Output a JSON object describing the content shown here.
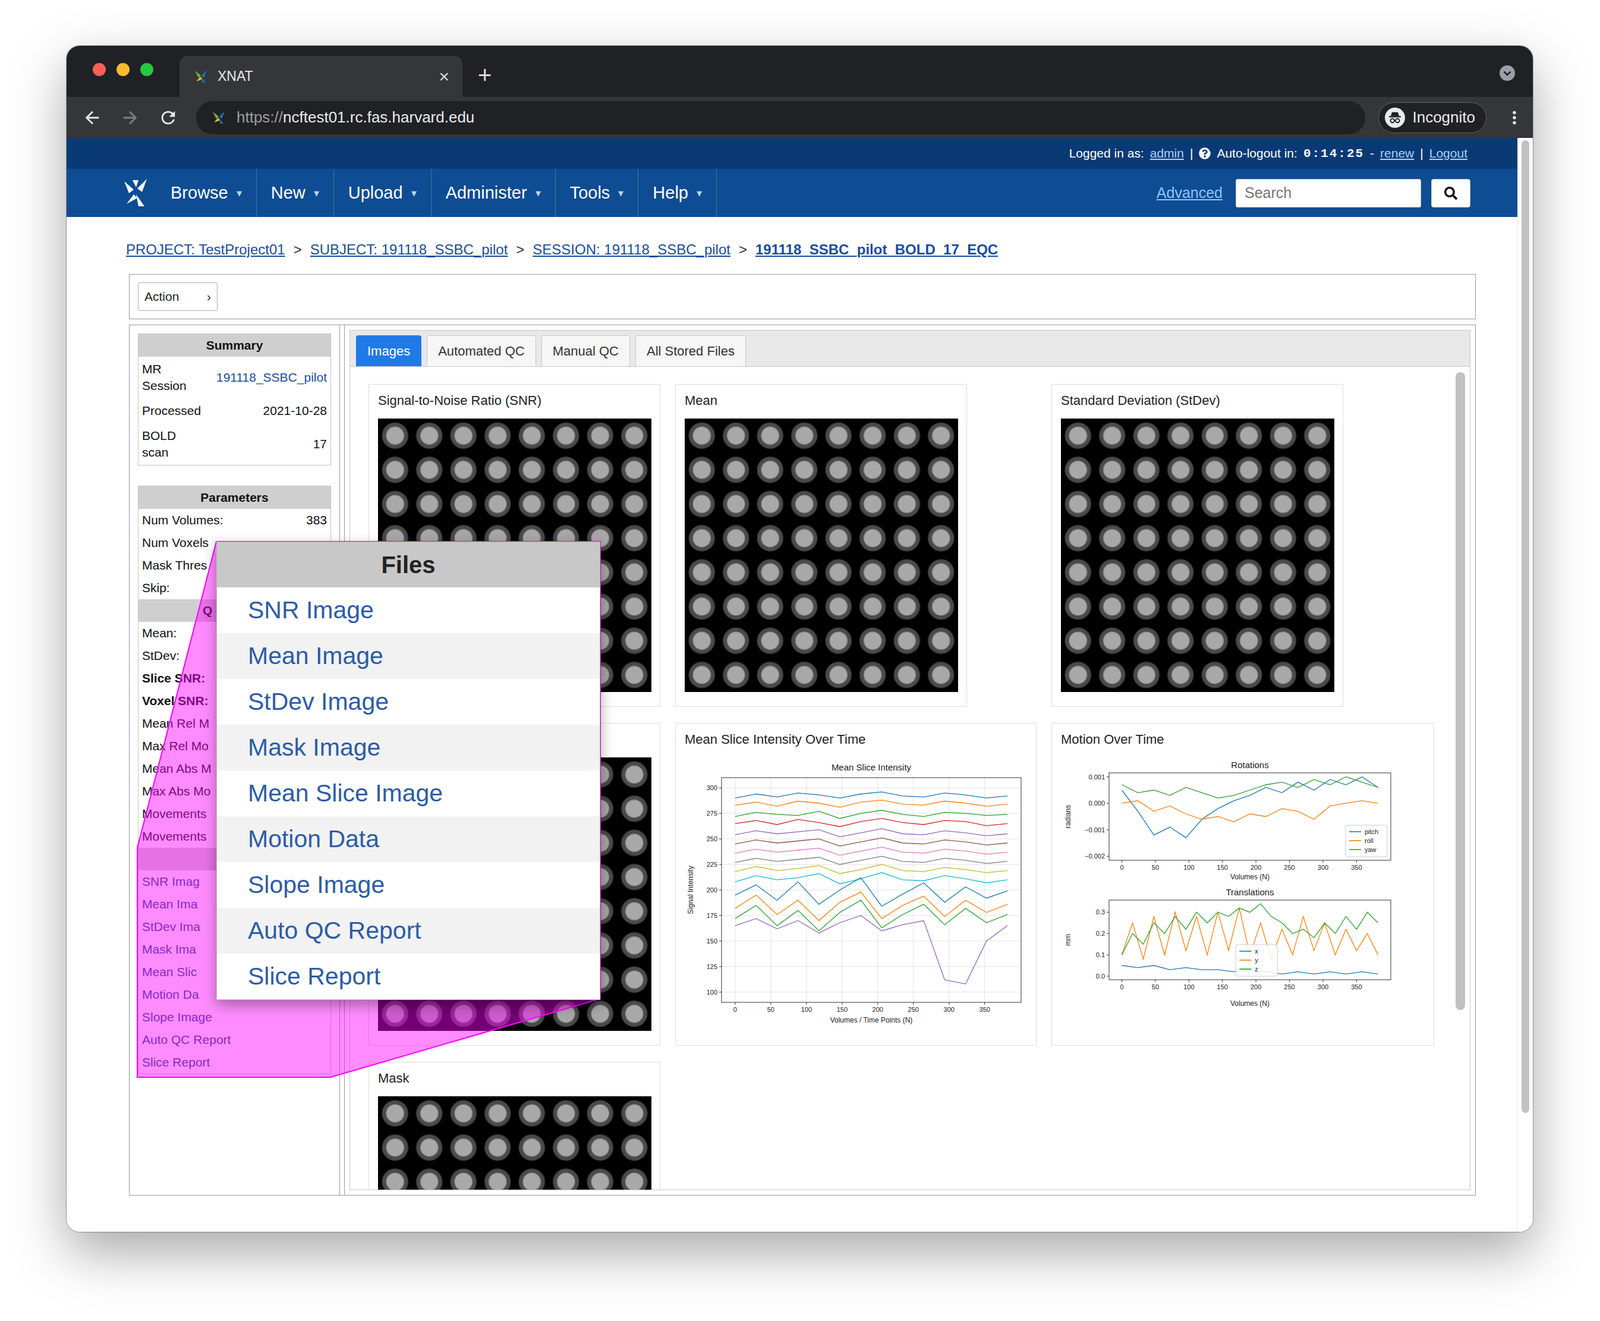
{
  "browser": {
    "tab": {
      "title": "XNAT",
      "close": "×",
      "selected": true
    },
    "new_tab": "+",
    "url": {
      "scheme": "https://",
      "host": "ncftest01.rc.fas.harvard.edu"
    },
    "profile": "Incognito"
  },
  "header": {
    "logged_in_label": "Logged in as:",
    "user": "admin",
    "separator": "|",
    "auto_logout_label": "Auto-logout in:",
    "timer": "0:14:25",
    "dash": "-",
    "renew": "renew",
    "logout": "Logout"
  },
  "nav": {
    "caret": "▾",
    "items": [
      {
        "label": "Browse"
      },
      {
        "label": "New"
      },
      {
        "label": "Upload"
      },
      {
        "label": "Administer"
      },
      {
        "label": "Tools"
      },
      {
        "label": "Help"
      }
    ],
    "advanced": "Advanced",
    "search": {
      "placeholder": "Search"
    }
  },
  "breadcrumb": {
    "separator": ">",
    "items": [
      {
        "label": "PROJECT: TestProject01",
        "current": false
      },
      {
        "label": "SUBJECT: 191118_SSBC_pilot",
        "current": false
      },
      {
        "label": "SESSION: 191118_SSBC_pilot",
        "current": false
      },
      {
        "label": "191118_SSBC_pilot_BOLD_17_EQC",
        "current": true
      }
    ]
  },
  "action": {
    "label": "Action",
    "chevron": "›"
  },
  "sidebar": {
    "summary": {
      "title": "Summary",
      "rows": [
        {
          "label": "MR Session",
          "value": "191118_SSBC_pilot",
          "link": true
        },
        {
          "label": "Processed",
          "value": "2021-10-28",
          "link": false
        },
        {
          "label": "BOLD scan",
          "value": "17",
          "link": false
        }
      ]
    },
    "parameters": {
      "title": "Parameters",
      "rows": [
        {
          "label": "Num Volumes:",
          "value": "383"
        },
        {
          "label": "Num Voxels"
        },
        {
          "label": "Mask Thres"
        },
        {
          "label": "Skip:"
        }
      ]
    },
    "qc": {
      "title": "Q",
      "rows": [
        {
          "label": "Mean:",
          "bold": false
        },
        {
          "label": "StDev:",
          "bold": false
        },
        {
          "label": "Slice SNR:",
          "bold": true
        },
        {
          "label": "Voxel SNR:",
          "bold": true
        },
        {
          "label": "Mean Rel M",
          "bold": false
        },
        {
          "label": "Max Rel Mo",
          "bold": false
        },
        {
          "label": "Mean Abs M",
          "bold": false
        },
        {
          "label": "Max Abs Mo",
          "bold": false
        },
        {
          "label": "Movements",
          "bold": false
        },
        {
          "label": "Movements",
          "bold": false
        }
      ]
    },
    "files": {
      "items": [
        "SNR Imag",
        "Mean Ima",
        "StDev Ima",
        "Mask Ima",
        "Mean Slic",
        "Motion Da",
        "Slope Image",
        "Auto QC Report",
        "Slice Report"
      ]
    }
  },
  "files_popup": {
    "title": "Files",
    "items": [
      "SNR Image",
      "Mean Image",
      "StDev Image",
      "Mask Image",
      "Mean Slice Image",
      "Motion Data",
      "Slope Image",
      "Auto QC Report",
      "Slice Report"
    ]
  },
  "tabs": [
    {
      "label": "Images",
      "selected": true
    },
    {
      "label": "Automated QC",
      "selected": false
    },
    {
      "label": "Manual QC",
      "selected": false
    },
    {
      "label": "All Stored Files",
      "selected": false
    }
  ],
  "cards": [
    {
      "kind": "image",
      "title": "Signal-to-Noise Ratio (SNR)"
    },
    {
      "kind": "image",
      "title": "Mean"
    },
    {
      "kind": "image",
      "title": "Standard Deviation (StDev)"
    },
    {
      "kind": "image"
    },
    {
      "kind": "intensity",
      "title": "Mean Slice Intensity Over Time",
      "chart": {
        "title": "Mean Slice Intensity",
        "y_label": "Signal Intensity",
        "x_label": "Volumes / Time Points (N)",
        "x_range": [
          0,
          382
        ],
        "x_ticks": [
          "0",
          "50",
          "100",
          "150",
          "200",
          "250",
          "300",
          "350"
        ],
        "y_ticks": [
          "100",
          "125",
          "150",
          "175",
          "200",
          "225",
          "250",
          "275",
          "300"
        ],
        "series": [
          {
            "color": "#1f77b4",
            "values": [
              290,
              294,
              291,
              295,
              293,
              290,
              294,
              296,
              292,
              291,
              295,
              293,
              290,
              292
            ]
          },
          {
            "color": "#ff7f0e",
            "values": [
              283,
              286,
              282,
              287,
              285,
              281,
              286,
              288,
              284,
              283,
              287,
              285,
              282,
              284
            ]
          },
          {
            "color": "#2ca02c",
            "values": [
              272,
              276,
              274,
              273,
              277,
              270,
              275,
              278,
              274,
              272,
              276,
              275,
              273,
              274
            ]
          },
          {
            "color": "#d62728",
            "values": [
              265,
              268,
              264,
              269,
              266,
              262,
              267,
              270,
              266,
              264,
              268,
              267,
              263,
              265
            ]
          },
          {
            "color": "#9467bd",
            "values": [
              254,
              258,
              255,
              257,
              259,
              252,
              256,
              260,
              255,
              254,
              258,
              256,
              253,
              255
            ]
          },
          {
            "color": "#8c564b",
            "values": [
              245,
              249,
              246,
              248,
              250,
              243,
              247,
              251,
              246,
              245,
              249,
              247,
              244,
              246
            ]
          },
          {
            "color": "#e377c2",
            "values": [
              236,
              240,
              237,
              239,
              241,
              234,
              238,
              242,
              237,
              236,
              240,
              238,
              235,
              237
            ]
          },
          {
            "color": "#7f7f7f",
            "values": [
              227,
              231,
              228,
              230,
              232,
              225,
              229,
              233,
              228,
              227,
              231,
              229,
              226,
              228
            ]
          },
          {
            "color": "#bcbd22",
            "values": [
              218,
              223,
              219,
              221,
              224,
              216,
              220,
              225,
              219,
              218,
              222,
              220,
              217,
              219
            ]
          },
          {
            "color": "#17becf",
            "values": [
              208,
              214,
              210,
              212,
              216,
              206,
              211,
              217,
              210,
              209,
              214,
              211,
              207,
              210
            ]
          },
          {
            "color": "#1f77b4",
            "values": [
              195,
              205,
              190,
              208,
              186,
              200,
              212,
              184,
              196,
              207,
              188,
              203,
              192,
              199
            ]
          },
          {
            "color": "#ff7f0e",
            "values": [
              182,
              195,
              176,
              190,
              170,
              188,
              198,
              172,
              185,
              194,
              174,
              190,
              178,
              186
            ]
          },
          {
            "color": "#2ca02c",
            "values": [
              172,
              185,
              165,
              180,
              160,
              178,
              190,
              163,
              176,
              186,
              166,
              182,
              168,
              176
            ]
          },
          {
            "color": "#9467bd",
            "values": [
              165,
              172,
              162,
              170,
              158,
              168,
              175,
              160,
              166,
              170,
              112,
              108,
              150,
              165
            ]
          }
        ]
      }
    },
    {
      "kind": "motion",
      "title": "Motion Over Time",
      "plots": [
        {
          "title": "Rotations",
          "y_label": "radians",
          "x_label": "Volumes (N)",
          "x_range": [
            0,
            382
          ],
          "x_ticks": [
            "0",
            "50",
            "100",
            "150",
            "200",
            "250",
            "300",
            "350"
          ],
          "y_ticks": [
            "−0.002",
            "−0.001",
            "0.000",
            "0.001"
          ],
          "series": [
            {
              "label": "pitch",
              "color": "#1f77b4",
              "values": [
                0.0005,
                -0.0003,
                -0.0012,
                -0.0009,
                -0.0013,
                -0.0006,
                -0.0002,
                0.0001,
                0.0003,
                0.0006,
                0.0004,
                0.0008,
                0.0005,
                0.0009,
                0.0007,
                0.001,
                0.0006
              ]
            },
            {
              "label": "roll",
              "color": "#ff7f0e",
              "values": [
                0.0,
                0.0001,
                -0.0003,
                -0.0001,
                -0.0004,
                -0.0006,
                -0.0005,
                -0.0007,
                -0.0004,
                -0.0005,
                -0.0002,
                -0.0003,
                -0.0006,
                -0.0001,
                0.0,
                0.0001,
                0.0
              ]
            },
            {
              "label": "yaw",
              "color": "#2ca02c",
              "values": [
                0.0007,
                0.0004,
                0.0005,
                0.0003,
                0.0006,
                0.0004,
                0.0002,
                0.0003,
                0.0005,
                0.0007,
                0.0008,
                0.0006,
                0.0009,
                0.0007,
                0.001,
                0.0008,
                0.0006
              ]
            }
          ]
        },
        {
          "title": "Translations",
          "y_label": "mm",
          "x_label": "Volumes (N)",
          "x_range": [
            0,
            382
          ],
          "x_ticks": [
            "0",
            "50",
            "100",
            "150",
            "200",
            "250",
            "300",
            "350"
          ],
          "y_ticks": [
            "0.0",
            "0.1",
            "0.2",
            "0.3"
          ],
          "series": [
            {
              "label": "x",
              "color": "#1f77b4",
              "values": [
                0.05,
                0.04,
                0.05,
                0.03,
                0.04,
                0.03,
                0.03,
                0.02,
                0.03,
                0.02,
                0.01,
                0.02,
                0.01,
                0.02,
                0.01,
                0.02,
                0.01
              ]
            },
            {
              "label": "y",
              "color": "#ff7f0e",
              "values": [
                0.1,
                0.25,
                0.08,
                0.28,
                0.1,
                0.3,
                0.12,
                0.28,
                0.1,
                0.3,
                0.12,
                0.32,
                0.1,
                0.25,
                0.08,
                0.22,
                0.1,
                0.28,
                0.12,
                0.25,
                0.1,
                0.22,
                0.12,
                0.2,
                0.1
              ]
            },
            {
              "label": "z",
              "color": "#2ca02c",
              "values": [
                0.1,
                0.2,
                0.15,
                0.25,
                0.2,
                0.28,
                0.22,
                0.3,
                0.25,
                0.3,
                0.28,
                0.32,
                0.3,
                0.34,
                0.28,
                0.25,
                0.2,
                0.22,
                0.18,
                0.25,
                0.2,
                0.28,
                0.22,
                0.3,
                0.25
              ]
            }
          ]
        }
      ]
    },
    {
      "kind": "image",
      "title": "Mask"
    }
  ]
}
